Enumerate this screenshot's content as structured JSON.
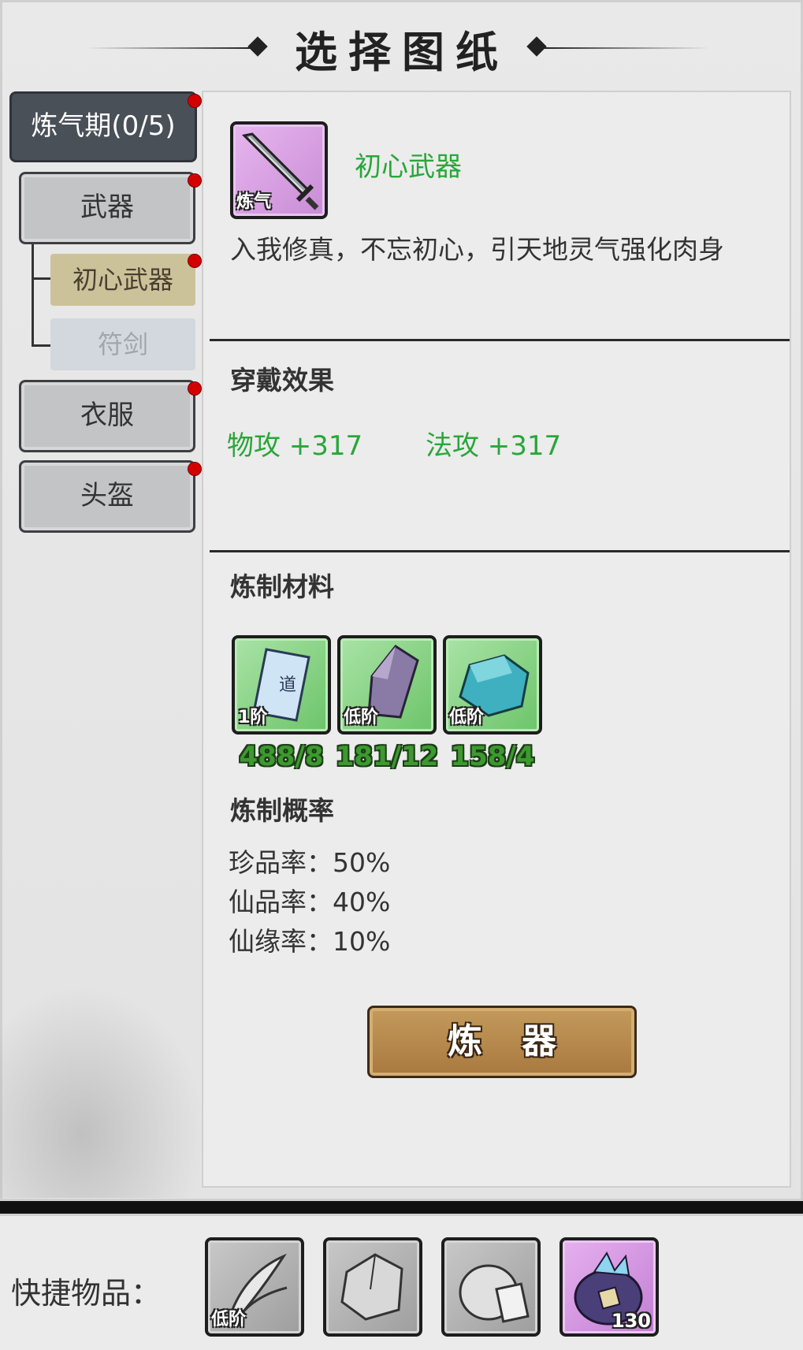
{
  "header": {
    "title": "选择图纸"
  },
  "sidebar": {
    "stage_tab": "炼气期(0/5)",
    "categories": [
      {
        "label": "武器"
      },
      {
        "label": "衣服"
      },
      {
        "label": "头盔"
      }
    ],
    "sub_items": [
      {
        "label": "初心武器",
        "state": "active"
      },
      {
        "label": "符剑",
        "state": "disabled"
      }
    ],
    "notification_color": "#d40000"
  },
  "item": {
    "icon": "sword-icon",
    "tag": "炼气",
    "name": "初心武器",
    "description": "入我修真，不忘初心，引天地灵气强化肉身"
  },
  "wear_effect": {
    "title": "穿戴效果",
    "stats": [
      {
        "text": "物攻 +317"
      },
      {
        "text": "法攻 +317"
      }
    ]
  },
  "materials": {
    "title": "炼制材料",
    "items": [
      {
        "icon": "talisman-scroll-icon",
        "tag": "1阶",
        "count": "488/8"
      },
      {
        "icon": "purple-crystal-icon",
        "tag": "低阶",
        "count": "181/12"
      },
      {
        "icon": "teal-ore-icon",
        "tag": "低阶",
        "count": "158/4"
      }
    ]
  },
  "probability": {
    "title": "炼制概率",
    "rates": [
      {
        "label": "珍品率：",
        "value": "50%"
      },
      {
        "label": "仙品率：",
        "value": "40%"
      },
      {
        "label": "仙缘率：",
        "value": "10%"
      }
    ]
  },
  "craft_button": {
    "label": "炼器"
  },
  "quick_items": {
    "label": "快捷物品：",
    "slots": [
      {
        "icon": "grass-herb-icon",
        "tag": "低阶",
        "count": ""
      },
      {
        "icon": "ore-rock-icon",
        "tag": "",
        "count": ""
      },
      {
        "icon": "pouch-scroll-icon",
        "tag": "",
        "count": ""
      },
      {
        "icon": "treasure-bag-icon",
        "tag": "",
        "count": "130"
      }
    ]
  },
  "colors": {
    "accent_green": "#2aa63a",
    "button_brown": "#b4874a",
    "stage_tab_bg": "#4a5058"
  }
}
